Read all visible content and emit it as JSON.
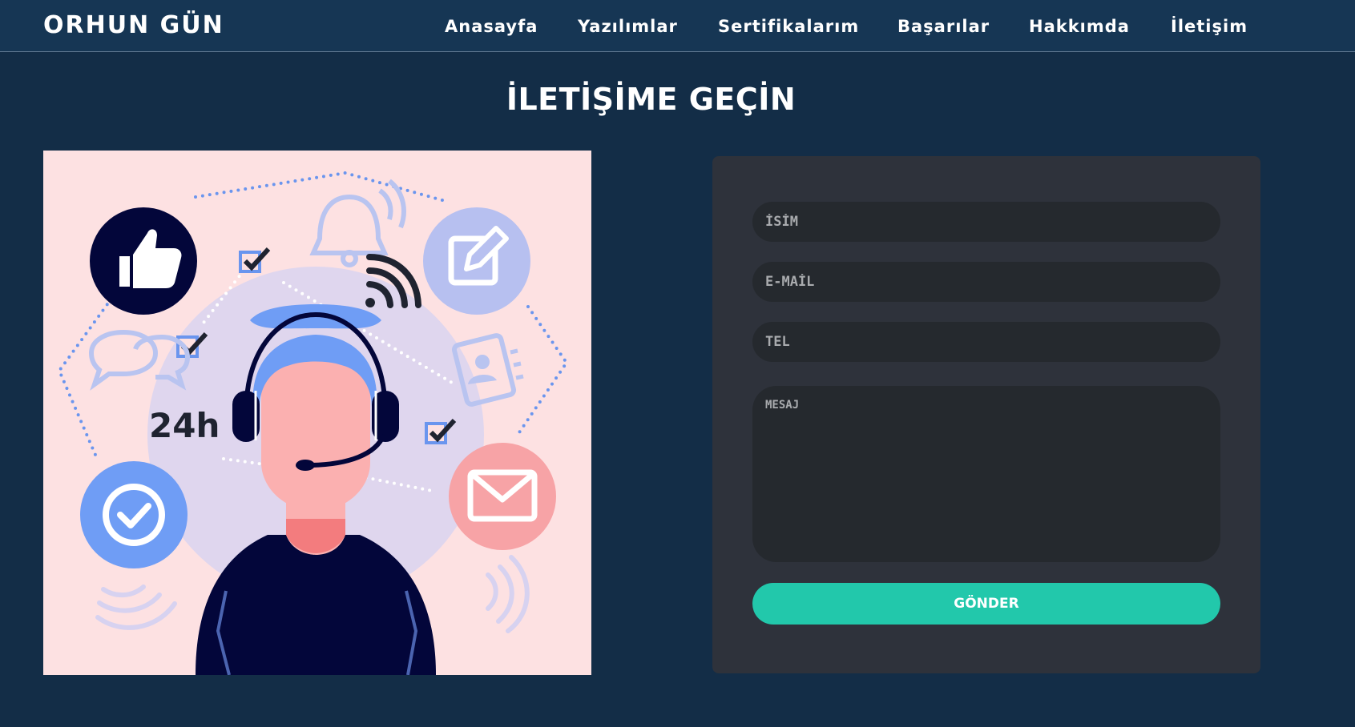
{
  "brand": "ORHUN GÜN",
  "nav": [
    {
      "label": "Anasayfa"
    },
    {
      "label": "Yazılımlar"
    },
    {
      "label": "Sertifikalarım"
    },
    {
      "label": "Başarılar"
    },
    {
      "label": "Hakkımda"
    },
    {
      "label": "İletişim"
    }
  ],
  "page_title": "İLETİŞİME GEÇİN",
  "illustration": {
    "badge_text": "24h",
    "colors": {
      "background": "#fde1e2",
      "navy": "#03063a",
      "blue": "#6f9df5",
      "pink": "#f7a3a6",
      "lavender": "#b7c0f0"
    }
  },
  "form": {
    "name_placeholder": "İSİM",
    "email_placeholder": "E-MAİL",
    "phone_placeholder": "TEL",
    "message_placeholder": "MESAJ",
    "submit_label": "GÖNDER"
  },
  "colors": {
    "page_background": "#132d47",
    "navbar_background": "#163654",
    "form_panel": "#2e323b",
    "field_background": "#25292e",
    "submit_button": "#22c8ab"
  }
}
